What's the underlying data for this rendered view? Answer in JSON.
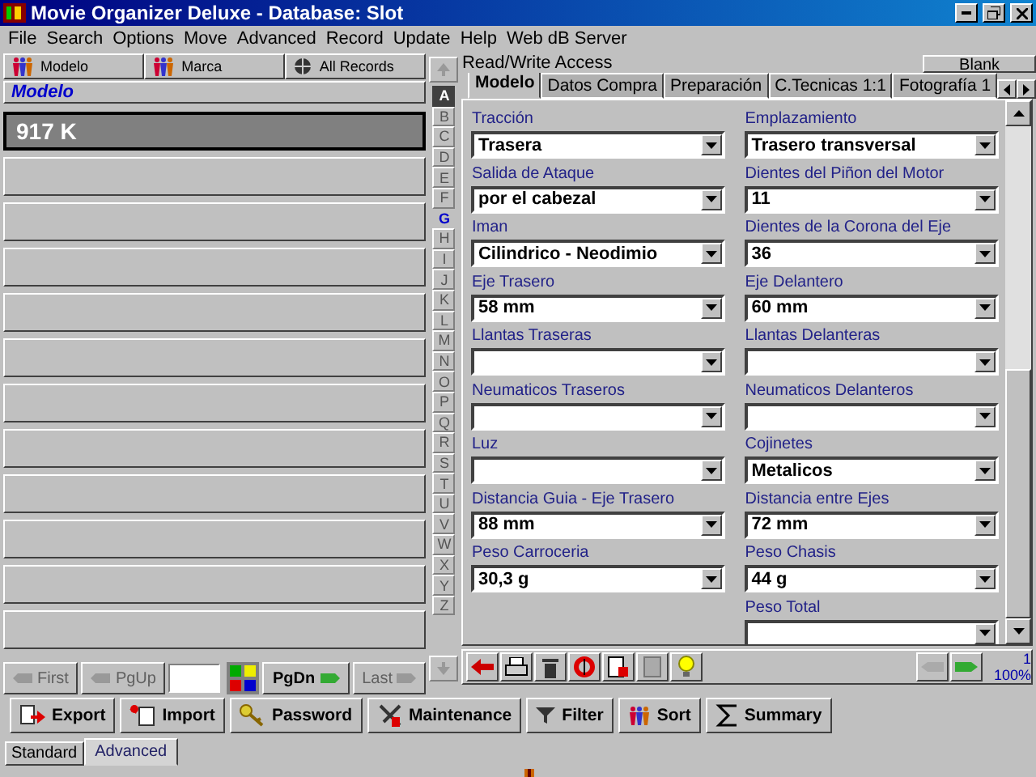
{
  "window": {
    "title": "Movie Organizer Deluxe - Database: Slot"
  },
  "menu": [
    "File",
    "Search",
    "Options",
    "Move",
    "Advanced",
    "Record",
    "Update",
    "Help",
    "Web dB Server"
  ],
  "view_buttons": [
    {
      "label": "Modelo",
      "kind": "people"
    },
    {
      "label": "Marca",
      "kind": "people"
    },
    {
      "label": "All Records",
      "kind": "globe"
    }
  ],
  "list_header": "Modelo",
  "records": [
    {
      "text": "917 K",
      "selected": true
    },
    {
      "selected": false
    },
    {
      "selected": false
    },
    {
      "selected": false
    },
    {
      "selected": false
    },
    {
      "selected": false
    },
    {
      "selected": false
    },
    {
      "selected": false
    },
    {
      "selected": false
    },
    {
      "selected": false
    },
    {
      "selected": false
    },
    {
      "selected": false
    }
  ],
  "nav": [
    {
      "label": "First",
      "disabled": true,
      "kind": "back"
    },
    {
      "label": "PgUp",
      "disabled": true,
      "kind": "back"
    },
    {
      "label": "PgDn",
      "disabled": false,
      "kind": "forward"
    },
    {
      "label": "Last",
      "disabled": true,
      "kind": "forward"
    }
  ],
  "alphabet": [
    {
      "letter": "A",
      "selected": true,
      "enabled": true
    },
    {
      "letter": "B",
      "selected": false,
      "enabled": false
    },
    {
      "letter": "C",
      "selected": false,
      "enabled": false
    },
    {
      "letter": "D",
      "selected": false,
      "enabled": false
    },
    {
      "letter": "E",
      "selected": false,
      "enabled": false
    },
    {
      "letter": "F",
      "selected": false,
      "enabled": false
    },
    {
      "letter": "G",
      "selected": false,
      "enabled": true
    },
    {
      "letter": "H",
      "selected": false,
      "enabled": false
    },
    {
      "letter": "I",
      "selected": false,
      "enabled": false
    },
    {
      "letter": "J",
      "selected": false,
      "enabled": false
    },
    {
      "letter": "K",
      "selected": false,
      "enabled": false
    },
    {
      "letter": "L",
      "selected": false,
      "enabled": false
    },
    {
      "letter": "M",
      "selected": false,
      "enabled": false
    },
    {
      "letter": "N",
      "selected": false,
      "enabled": false
    },
    {
      "letter": "O",
      "selected": false,
      "enabled": false
    },
    {
      "letter": "P",
      "selected": false,
      "enabled": false
    },
    {
      "letter": "Q",
      "selected": false,
      "enabled": false
    },
    {
      "letter": "R",
      "selected": false,
      "enabled": false
    },
    {
      "letter": "S",
      "selected": false,
      "enabled": false
    },
    {
      "letter": "T",
      "selected": false,
      "enabled": false
    },
    {
      "letter": "U",
      "selected": false,
      "enabled": false
    },
    {
      "letter": "V",
      "selected": false,
      "enabled": false
    },
    {
      "letter": "W",
      "selected": false,
      "enabled": false
    },
    {
      "letter": "X",
      "selected": false,
      "enabled": false
    },
    {
      "letter": "Y",
      "selected": false,
      "enabled": false
    },
    {
      "letter": "Z",
      "selected": false,
      "enabled": false
    }
  ],
  "access": "Read/Write Access",
  "blank_button": "Blank",
  "tabs": [
    {
      "label": "Modelo",
      "selected": true
    },
    {
      "label": "Datos Compra",
      "selected": false
    },
    {
      "label": "Preparación",
      "selected": false
    },
    {
      "label": "C.Tecnicas 1:1",
      "selected": false
    },
    {
      "label": "Fotografía 1",
      "selected": false
    }
  ],
  "fields": [
    {
      "label": "Tracción",
      "value": "Trasera"
    },
    {
      "label": "Emplazamiento",
      "value": "Trasero transversal"
    },
    {
      "label": "Salida de Ataque",
      "value": "por el cabezal"
    },
    {
      "label": "Dientes del Piñon del Motor",
      "value": "11"
    },
    {
      "label": "Iman",
      "value": "Cilindrico - Neodimio"
    },
    {
      "label": "Dientes de la Corona del Eje",
      "value": "36"
    },
    {
      "label": "Eje Trasero",
      "value": "58 mm"
    },
    {
      "label": "Eje Delantero",
      "value": "60 mm"
    },
    {
      "label": "Llantas Traseras"
    },
    {
      "label": "Llantas Delanteras"
    },
    {
      "label": "Neumaticos Traseros"
    },
    {
      "label": "Neumaticos Delanteros"
    },
    {
      "label": "Luz"
    },
    {
      "label": "Cojinetes",
      "value": "Metalicos"
    },
    {
      "label": "Distancia Guia - Eje Trasero",
      "value": "88 mm"
    },
    {
      "label": "Distancia entre Ejes",
      "value": "72 mm"
    },
    {
      "label": "Peso Carroceria",
      "value": "30,3 g"
    },
    {
      "label": "Peso Chasis",
      "value": "44 g"
    },
    {
      "label": "Peso Total"
    }
  ],
  "record_status": {
    "number": "1",
    "zoom": "100%"
  },
  "actions": [
    {
      "label": "Export",
      "kind": "export"
    },
    {
      "label": "Import",
      "kind": "import"
    },
    {
      "label": "Password",
      "kind": "key"
    },
    {
      "label": "Maintenance",
      "kind": "tools"
    },
    {
      "label": "Filter",
      "kind": "filter"
    },
    {
      "label": "Sort",
      "kind": "people"
    },
    {
      "label": "Summary",
      "kind": "sigma"
    }
  ],
  "mode_tabs": [
    {
      "label": "Standard",
      "selected": false
    },
    {
      "label": "Advanced",
      "selected": true
    }
  ]
}
